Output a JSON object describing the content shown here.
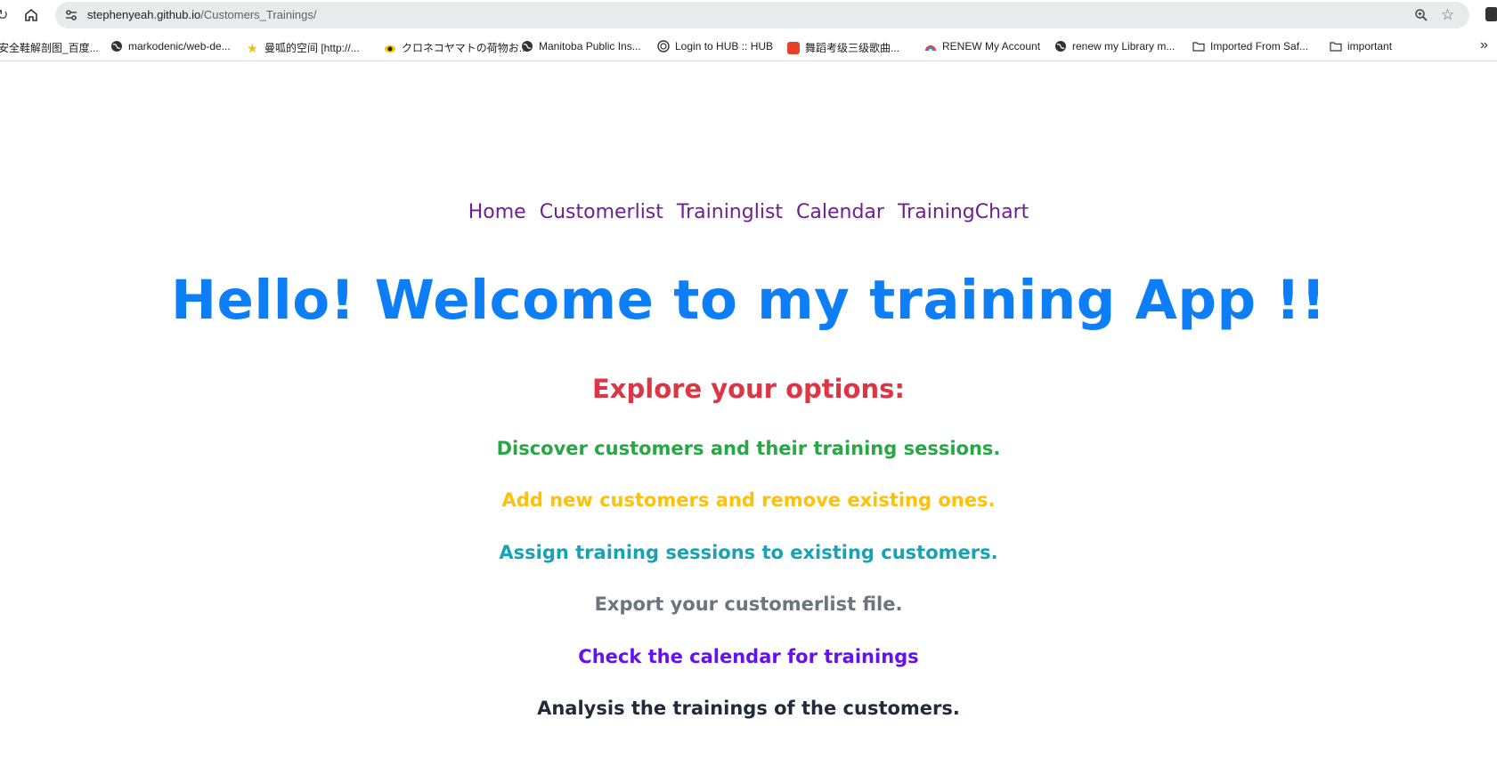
{
  "browser": {
    "url_host": "stephenyeah.github.io",
    "url_path": "/Customers_Trainings/",
    "bookmarks": [
      {
        "label": "安全鞋解剖图_百度...",
        "icon": "page-icon"
      },
      {
        "label": "markodenic/web-de...",
        "icon": "globe-icon"
      },
      {
        "label": "曼呱的空间 [http://...",
        "icon": "star-icon"
      },
      {
        "label": "クロネコヤマトの荷物お...",
        "icon": "cat-icon"
      },
      {
        "label": "Manitoba Public Ins...",
        "icon": "globe-icon"
      },
      {
        "label": "Login to HUB :: HUB",
        "icon": "hub-icon"
      },
      {
        "label": "舞蹈考级三级歌曲...",
        "icon": "app-icon"
      },
      {
        "label": "RENEW My Account",
        "icon": "rainbow-icon"
      },
      {
        "label": "renew my Library m...",
        "icon": "globe-icon"
      },
      {
        "label": "Imported From Saf...",
        "icon": "folder-icon"
      },
      {
        "label": "important",
        "icon": "folder-icon"
      }
    ]
  },
  "nav": {
    "home": "Home",
    "customerlist": "Customerlist",
    "traininglist": "Traininglist",
    "calendar": "Calendar",
    "trainingchart": "TrainingChart"
  },
  "heading": "Hello! Welcome to my training App !!",
  "subheading": "Explore your options:",
  "options": [
    {
      "text": "Discover customers and their training sessions.",
      "color": "#28a745"
    },
    {
      "text": "Add new customers and remove existing ones.",
      "color": "#ffc107"
    },
    {
      "text": "Assign training sessions to existing customers.",
      "color": "#17a2b8"
    },
    {
      "text": "Export your customerlist file.",
      "color": "#6c757d"
    },
    {
      "text": "Check the calendar for trainings",
      "color": "#6610f2"
    },
    {
      "text": "Analysis the trainings of the customers.",
      "color": "#212b39"
    }
  ]
}
